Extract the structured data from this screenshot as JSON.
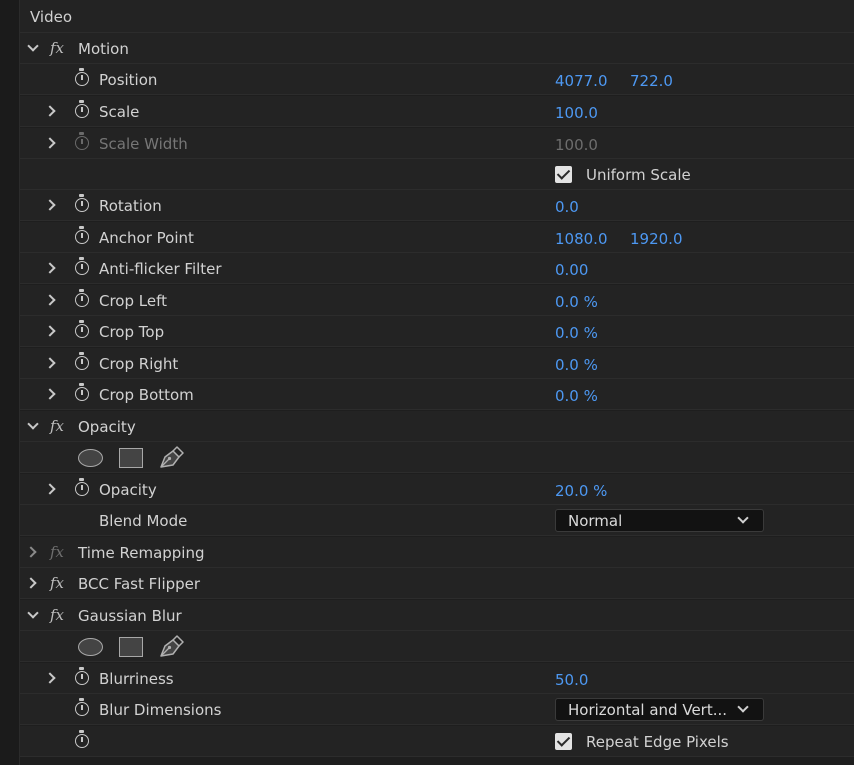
{
  "panel": {
    "section": "Video",
    "motion": {
      "name": "Motion",
      "position": {
        "label": "Position",
        "x": "4077.0",
        "y": "722.0"
      },
      "scale": {
        "label": "Scale",
        "value": "100.0"
      },
      "scale_width": {
        "label": "Scale Width",
        "value": "100.0"
      },
      "uniform_scale": {
        "label": "Uniform Scale",
        "checked": true
      },
      "rotation": {
        "label": "Rotation",
        "value": "0.0"
      },
      "anchor_point": {
        "label": "Anchor Point",
        "x": "1080.0",
        "y": "1920.0"
      },
      "anti_flicker": {
        "label": "Anti-flicker Filter",
        "value": "0.00"
      },
      "crop_left": {
        "label": "Crop Left",
        "value": "0.0 %"
      },
      "crop_top": {
        "label": "Crop Top",
        "value": "0.0 %"
      },
      "crop_right": {
        "label": "Crop Right",
        "value": "0.0 %"
      },
      "crop_bottom": {
        "label": "Crop Bottom",
        "value": "0.0 %"
      }
    },
    "opacity": {
      "name": "Opacity",
      "opacity": {
        "label": "Opacity",
        "value": "20.0 %"
      },
      "blend_mode": {
        "label": "Blend Mode",
        "value": "Normal"
      }
    },
    "time_remapping": {
      "name": "Time Remapping"
    },
    "bcc_fast_flipper": {
      "name": "BCC Fast Flipper"
    },
    "gaussian_blur": {
      "name": "Gaussian Blur",
      "blurriness": {
        "label": "Blurriness",
        "value": "50.0"
      },
      "blur_dimensions": {
        "label": "Blur Dimensions",
        "value": "Horizontal and Vert..."
      },
      "repeat_edge": {
        "label": "Repeat Edge Pixels",
        "checked": true
      }
    }
  },
  "colors": {
    "value_blue": "#4d98f2",
    "background": "#232323",
    "disabled": "#767676"
  }
}
